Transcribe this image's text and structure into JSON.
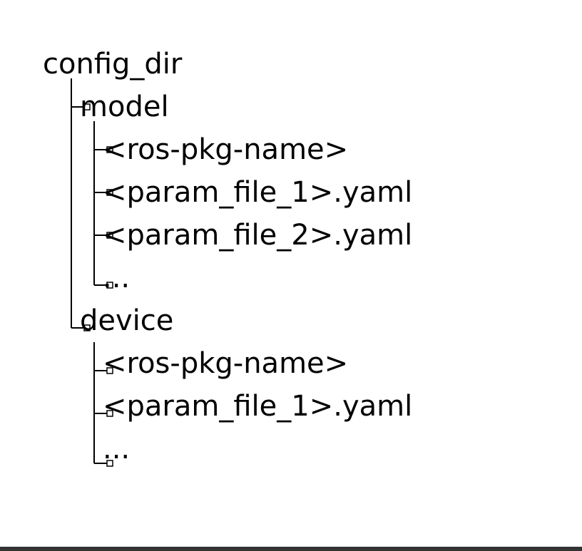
{
  "tree": {
    "root": "config_dir",
    "children": [
      {
        "label": "model",
        "children": [
          {
            "label": "<ros-pkg-name>",
            "children": []
          },
          {
            "label": "<param_file_1>.yaml",
            "children": []
          },
          {
            "label": "<param_file_2>.yaml",
            "children": []
          },
          {
            "label": "...",
            "children": []
          }
        ]
      },
      {
        "label": "device",
        "children": [
          {
            "label": "<ros-pkg-name>",
            "children": []
          },
          {
            "label": "<param_file_1>.yaml",
            "children": []
          },
          {
            "label": "...",
            "children": []
          }
        ]
      }
    ]
  }
}
